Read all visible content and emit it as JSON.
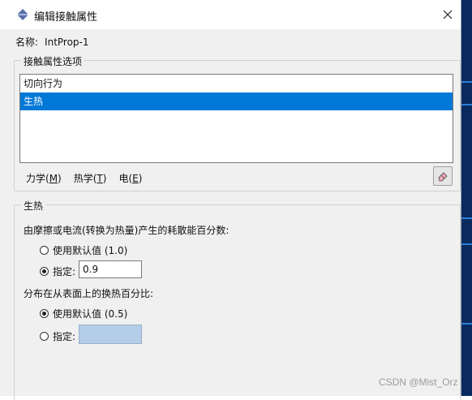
{
  "window": {
    "title": "编辑接触属性",
    "close_label": "✕"
  },
  "name_field": {
    "label": "名称:",
    "value": "IntProp-1"
  },
  "options_group": {
    "label": "接触属性选项",
    "items": [
      {
        "label": "切向行为",
        "selected": false
      },
      {
        "label": "生热",
        "selected": true
      }
    ],
    "menus": [
      {
        "label": "力学(",
        "mnemonic": "M",
        "suffix": ")"
      },
      {
        "label": "热学(",
        "mnemonic": "T",
        "suffix": ")"
      },
      {
        "label": "电(",
        "mnemonic": "E",
        "suffix": ")"
      }
    ]
  },
  "heat_group": {
    "label": "生热",
    "q1": {
      "text": "由摩擦或电流(转换为热量)产生的耗散能百分数:",
      "default_option": "使用默认值 (1.0)",
      "specify_label": "指定:",
      "specify_value": "0.9",
      "selected": "specify"
    },
    "q2": {
      "text": "分布在从表面上的换热百分比:",
      "default_option": "使用默认值 (0.5)",
      "specify_label": "指定:",
      "specify_value": "",
      "selected": "default"
    }
  },
  "watermark": "CSDN @Mist_Orz",
  "colors": {
    "selection": "#0078d7",
    "disabled_field": "#b4cde9",
    "background_app": "#0a2a5e"
  }
}
